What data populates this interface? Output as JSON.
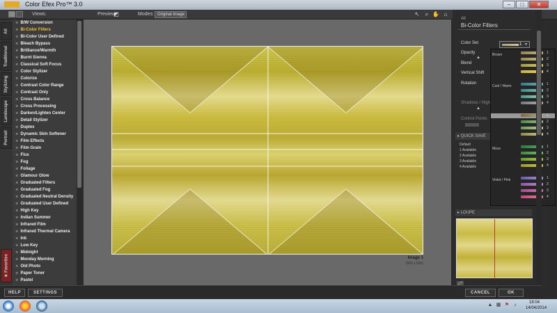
{
  "window": {
    "logo_text": "",
    "title": "Color Efex Pro™ 3.0",
    "controls": [
      "–",
      "□",
      "✕"
    ]
  },
  "toolbar": {
    "views_label": "Views:",
    "preview_label": "Preview:",
    "modes_label": "Modes:",
    "modes_value": "Original Image"
  },
  "left_tabs": [
    "All",
    "Traditional",
    "Stylizing",
    "Landscape",
    "Portrait",
    "★ Favorites"
  ],
  "filters": [
    "B/W Conversion",
    "Bi-Color Filters",
    "Bi-Color User Defined",
    "Bleach Bypass",
    "Brilliance/Warmth",
    "Burnt Sienna",
    "Classical Soft Focus",
    "Color Stylizer",
    "Colorize",
    "Contrast Color Range",
    "Contrast Only",
    "Cross Balance",
    "Cross Processing",
    "Darken/Lighten Center",
    "Detail Stylizer",
    "Duplex",
    "Dynamic Skin Softener",
    "Film Effects",
    "Film Grain",
    "Flux",
    "Fog",
    "Foliage",
    "Glamour Glow",
    "Graduated Filters",
    "Graduated Fog",
    "Graduated Neutral Density",
    "Graduated User Defined",
    "High Key",
    "Indian Summer",
    "Infrared Film",
    "Infrared Thermal Camera",
    "Ink",
    "Low Key",
    "Midnight",
    "Monday Morning",
    "Old Photo",
    "Paper Toner",
    "Pastel"
  ],
  "selected_filter_index": 1,
  "preview": {
    "image_label": "Image 1",
    "image_size": "(900 x 600)"
  },
  "right_panel": {
    "category": "All",
    "filter_name": "Bi-Color Filters",
    "controls": [
      "Color Set",
      "Opacity",
      "Blend",
      "Vertical Shift",
      "Rotation"
    ],
    "shadows_label": "Shadows / Highli",
    "control_points_label": "Control Points",
    "quick_save_title": "QUICK SAVE",
    "quick_save_items": [
      "Default",
      "1  Available",
      "2  Available",
      "3  Available",
      "4  Available"
    ],
    "loupe_title": "LOUPE",
    "colorset_value": "1"
  },
  "dropdown": {
    "groups": [
      {
        "name": "Brown",
        "swatches": [
          {
            "num": "1",
            "c1": "#8f8456",
            "c2": "#c6b67c"
          },
          {
            "num": "2",
            "c1": "#9a8a4c",
            "c2": "#d0bd76"
          },
          {
            "num": "3",
            "c1": "#a89a3e",
            "c2": "#d9cd6c"
          },
          {
            "num": "4",
            "c1": "#c7b23a",
            "c2": "#e5d36a"
          }
        ]
      },
      {
        "name": "Cool / Warm",
        "swatches": [
          {
            "num": "1",
            "c1": "#3a7a8a",
            "c2": "#6ab0c0"
          },
          {
            "num": "2",
            "c1": "#3a8a8a",
            "c2": "#7cc4b8"
          },
          {
            "num": "3",
            "c1": "#4a9a8a",
            "c2": "#9ad0c0"
          },
          {
            "num": "4",
            "c1": "#6a7a8a",
            "c2": "#c0b0a0"
          }
        ]
      },
      {
        "name": "Green / Brown",
        "swatches": [
          {
            "num": "1",
            "c1": "#7a6a3a",
            "c2": "#b6a878"
          },
          {
            "num": "2",
            "c1": "#4a8a4a",
            "c2": "#9ac08a"
          },
          {
            "num": "3",
            "c1": "#6a9a5a",
            "c2": "#c0d090"
          },
          {
            "num": "4",
            "c1": "#8a8a4a",
            "c2": "#d6c88a"
          }
        ]
      },
      {
        "name": "Moss",
        "swatches": [
          {
            "num": "1",
            "c1": "#2a7a3a",
            "c2": "#5aa86a"
          },
          {
            "num": "2",
            "c1": "#3a8a3a",
            "c2": "#7ac06a"
          },
          {
            "num": "3",
            "c1": "#6a9a2a",
            "c2": "#b0c84a"
          },
          {
            "num": "4",
            "c1": "#9a9a2a",
            "c2": "#d4c84a"
          }
        ]
      },
      {
        "name": "Violet / Pink",
        "swatches": [
          {
            "num": "1",
            "c1": "#6a5aa8",
            "c2": "#a89ad8"
          },
          {
            "num": "2",
            "c1": "#8a5aa8",
            "c2": "#c08ad0"
          },
          {
            "num": "3",
            "c1": "#a84a8a",
            "c2": "#d07ab8"
          },
          {
            "num": "4",
            "c1": "#c04a7a",
            "c2": "#e07aa0"
          }
        ]
      }
    ]
  },
  "bottom": {
    "help": "HELP",
    "settings": "SETTINGS",
    "cancel": "CANCEL",
    "ok": "OK"
  },
  "taskbar": {
    "time": "18:04",
    "date": "14/04/2014"
  },
  "colors": {
    "accent": "#f0c040",
    "favorites_tab": "#7a2222"
  }
}
